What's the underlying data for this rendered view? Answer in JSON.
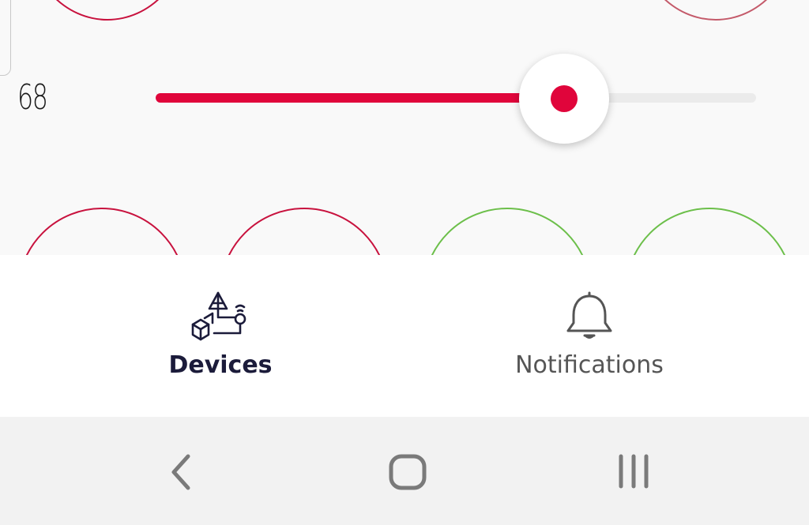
{
  "slider": {
    "value_label": "68",
    "level_percent": 68,
    "accent_color": "#e0053b",
    "track_color": "#ebebeb"
  },
  "bottom_nav": {
    "items": [
      {
        "label": "Devices",
        "icon": "devices-icon",
        "active": true,
        "color": "#1b1b3a"
      },
      {
        "label": "Notifications",
        "icon": "bell-icon",
        "active": false,
        "color": "#555555"
      }
    ]
  },
  "system_nav": {
    "buttons": [
      "back-icon",
      "home-icon",
      "recents-icon"
    ]
  },
  "colors": {
    "ring_red": "#c8123e",
    "ring_green": "#6cbf4a"
  }
}
